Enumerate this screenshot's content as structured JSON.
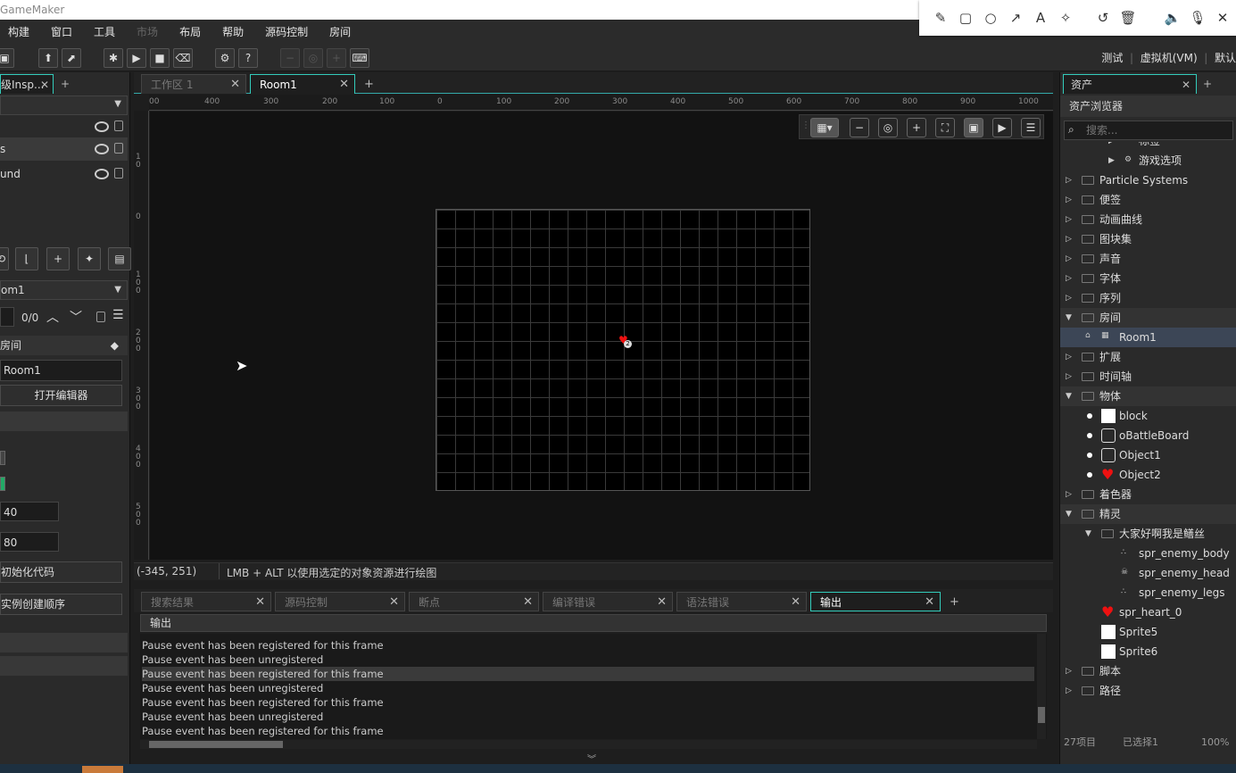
{
  "app": {
    "title": "GameMaker"
  },
  "menu": [
    "构建",
    "窗口",
    "工具",
    "市场",
    "布局",
    "帮助",
    "源码控制",
    "房间"
  ],
  "menu_disabled": [
    "市场"
  ],
  "toolbar": {
    "target_test": "测试",
    "target_vm": "虚拟机(VM)",
    "target_default": "默认"
  },
  "annotation_tools": [
    "pencil-icon",
    "rectangle-icon",
    "circle-icon",
    "arrow-icon",
    "text-icon",
    "magic-wand-icon",
    "undo-icon",
    "delete-icon",
    "volume-icon",
    "mic-icon",
    "close-icon"
  ],
  "left_panel": {
    "tab_label": "级Insp...",
    "layers": [
      "s",
      "und"
    ],
    "room_select": "om1",
    "counter": "0/0",
    "section_label": "房间",
    "room_name": "Room1",
    "open_editor": "打开编辑器",
    "width_val": "40",
    "height_val": "80",
    "init_code": "初始化代码",
    "create_order": "实例创建顺序"
  },
  "center": {
    "tabs": [
      {
        "label": "工作区 1",
        "active": false
      },
      {
        "label": "Room1",
        "active": true
      }
    ],
    "ruler_h": [
      "00",
      "400",
      "300",
      "200",
      "100",
      "0",
      "100",
      "200",
      "300",
      "400",
      "500",
      "600",
      "700",
      "800",
      "900",
      "1000"
    ],
    "ruler_v": [
      "1\n0",
      "0",
      "1\n0\n0",
      "2\n0\n0",
      "3\n0\n0",
      "4\n0\n0",
      "5\n0\n0"
    ],
    "status_coords": "(-345, 251)",
    "status_hint": "LMB + ALT 以使用选定的对象资源进行绘图",
    "instance_badge": "2"
  },
  "bottom": {
    "tabs": [
      "搜索结果",
      "源码控制",
      "断点",
      "编译错误",
      "语法错误",
      "输出"
    ],
    "active_tab": "输出",
    "output_header": "输出",
    "lines": [
      "Pause event has been registered for this frame",
      "Pause event has been unregistered",
      "Pause event has been registered for this frame",
      "Pause event has been unregistered",
      "Pause event has been registered for this frame",
      "Pause event has been unregistered",
      "Pause event has been registered for this frame"
    ],
    "highlighted_line": 2
  },
  "right_panel": {
    "tab_label": "资产",
    "browser_title": "资产浏览器",
    "search_placeholder": "搜索...",
    "tree": [
      {
        "label": "标签",
        "indent": 2,
        "kind": "partial"
      },
      {
        "label": "游戏选项",
        "indent": 2,
        "kind": "gear"
      },
      {
        "label": "Particle Systems",
        "indent": 0,
        "kind": "folder"
      },
      {
        "label": "便签",
        "indent": 0,
        "kind": "folder"
      },
      {
        "label": "动画曲线",
        "indent": 0,
        "kind": "folder"
      },
      {
        "label": "图块集",
        "indent": 0,
        "kind": "folder"
      },
      {
        "label": "声音",
        "indent": 0,
        "kind": "folder"
      },
      {
        "label": "字体",
        "indent": 0,
        "kind": "folder"
      },
      {
        "label": "序列",
        "indent": 0,
        "kind": "folder"
      },
      {
        "label": "房间",
        "indent": 0,
        "kind": "folder-open"
      },
      {
        "label": "Room1",
        "indent": 1,
        "kind": "room",
        "selected": true
      },
      {
        "label": "扩展",
        "indent": 0,
        "kind": "folder"
      },
      {
        "label": "时间轴",
        "indent": 0,
        "kind": "folder"
      },
      {
        "label": "物体",
        "indent": 0,
        "kind": "folder-open"
      },
      {
        "label": "block",
        "indent": 1,
        "kind": "obj-white"
      },
      {
        "label": "oBattleBoard",
        "indent": 1,
        "kind": "obj-outline"
      },
      {
        "label": "Object1",
        "indent": 1,
        "kind": "obj-outline"
      },
      {
        "label": "Object2",
        "indent": 1,
        "kind": "obj-heart"
      },
      {
        "label": "着色器",
        "indent": 0,
        "kind": "folder"
      },
      {
        "label": "精灵",
        "indent": 0,
        "kind": "folder-open"
      },
      {
        "label": "大家好啊我是鳝丝",
        "indent": 1,
        "kind": "subfolder-open"
      },
      {
        "label": "spr_enemy_body",
        "indent": 2,
        "kind": "sprite-dark"
      },
      {
        "label": "spr_enemy_head",
        "indent": 2,
        "kind": "sprite-skull"
      },
      {
        "label": "spr_enemy_legs",
        "indent": 2,
        "kind": "sprite-dark"
      },
      {
        "label": "spr_heart_0",
        "indent": 1,
        "kind": "sprite-heart"
      },
      {
        "label": "Sprite5",
        "indent": 1,
        "kind": "sprite-white"
      },
      {
        "label": "Sprite6",
        "indent": 1,
        "kind": "sprite-white"
      },
      {
        "label": "脚本",
        "indent": 0,
        "kind": "folder"
      },
      {
        "label": "路径",
        "indent": 0,
        "kind": "folder"
      }
    ],
    "footer_count": "27项目",
    "footer_selected": "已选择1",
    "footer_zoom": "100%"
  }
}
